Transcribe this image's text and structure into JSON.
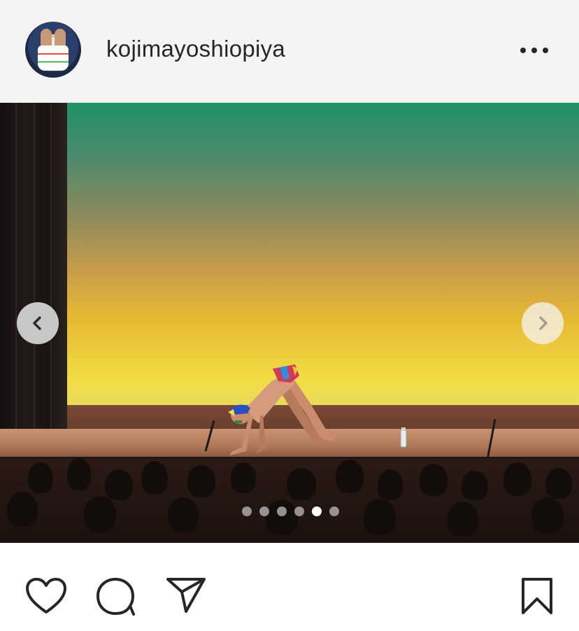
{
  "post": {
    "username": "kojimayoshiopiya",
    "avatar_icon": "profile-avatar",
    "more_icon": "more-options-icon"
  },
  "carousel": {
    "slide_count": 6,
    "active_index": 4,
    "prev_icon": "chevron-left-icon",
    "next_icon": "chevron-right-icon"
  },
  "actions": {
    "like_icon": "heart-icon",
    "comment_icon": "comment-icon",
    "share_icon": "send-icon",
    "save_icon": "bookmark-icon"
  },
  "colors": {
    "header_bg": "#f4f4f4",
    "icon_stroke": "#262626",
    "dot_active": "#ffffff",
    "dot_inactive": "#bebebe"
  }
}
